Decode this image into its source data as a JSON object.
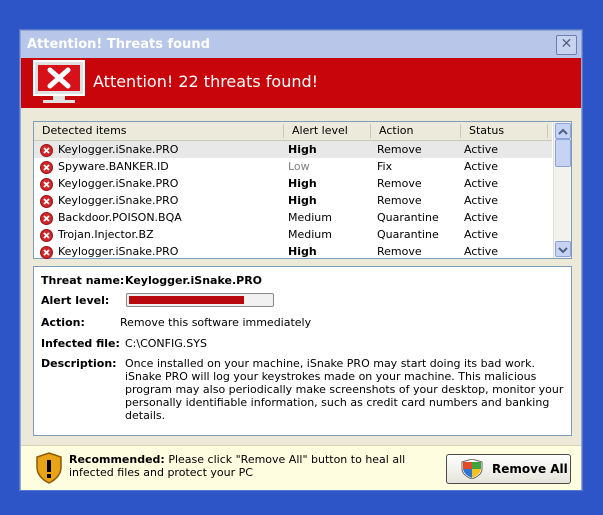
{
  "window": {
    "title": "Attention! Threats found",
    "banner_text": "Attention! 22 threats found!"
  },
  "list": {
    "columns": [
      "Detected items",
      "Alert level",
      "Action",
      "Status"
    ],
    "rows": [
      {
        "item": "Keylogger.iSnake.PRO",
        "level": "High",
        "action": "Remove",
        "status": "Active"
      },
      {
        "item": "Spyware.BANKER.ID",
        "level": "Low",
        "action": "Fix",
        "status": "Active"
      },
      {
        "item": "Keylogger.iSnake.PRO",
        "level": "High",
        "action": "Remove",
        "status": "Active"
      },
      {
        "item": "Keylogger.iSnake.PRO",
        "level": "High",
        "action": "Remove",
        "status": "Active"
      },
      {
        "item": "Backdoor.POISON.BQA",
        "level": "Medium",
        "action": "Quarantine",
        "status": "Active"
      },
      {
        "item": "Trojan.Injector.BZ",
        "level": "Medium",
        "action": "Quarantine",
        "status": "Active"
      },
      {
        "item": "Keylogger.iSnake.PRO",
        "level": "High",
        "action": "Remove",
        "status": "Active"
      }
    ]
  },
  "details": {
    "threat_name_label": "Threat name:",
    "threat_name": "Keylogger.iSnake.PRO",
    "alert_level_label": "Alert level:",
    "alert_level_fraction": 0.82,
    "action_label": "Action:",
    "action": "Remove this software immediately",
    "infected_file_label": "Infected file:",
    "infected_file": "C:\\CONFIG.SYS",
    "description_label": "Description:",
    "description": "Once installed on your machine, iSnake PRO may start doing its bad work. iSnake PRO will log your keystrokes made on your machine. This malicious program may also periodically make screenshots of your desktop, monitor your personally identifiable information, such as credit card numbers and banking details."
  },
  "footer": {
    "recommended_label": "Recommended:",
    "recommended_text": "Please click \"Remove All\" button to heal all infected files and protect your PC",
    "remove_all_label": "Remove All"
  },
  "colors": {
    "banner": "#c8050b",
    "high": "#000000",
    "low": "#808080"
  }
}
